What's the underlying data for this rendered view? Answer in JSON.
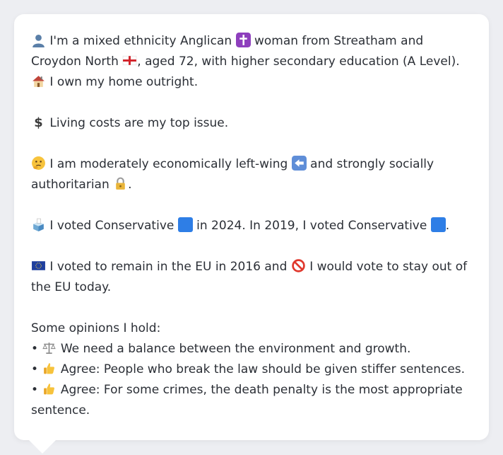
{
  "profile": {
    "intro_1": "I'm a mixed ethnicity Anglican",
    "intro_2": "woman from Streatham and Croydon North",
    "intro_3": ", aged 72, with higher secondary education (A Level).",
    "intro_4": "I own my home outright.",
    "issue": "Living costs are my top issue.",
    "politics_1": "I am moderately economically left-wing",
    "politics_2": "and strongly socially authoritarian",
    "politics_3": ".",
    "vote_1": "I voted Conservative",
    "vote_2": "in 2024. In 2019, I voted Conservative",
    "vote_3": ".",
    "eu_1": "I voted to remain in the EU in 2016 and",
    "eu_2": "I would vote to stay out of the EU today.",
    "opinions_heading": "Some opinions I hold:",
    "opinions": [
      {
        "bullet": "•",
        "text": "We need a balance between the environment and growth."
      },
      {
        "bullet": "•",
        "text": "Agree: People who break the law should be given stiffer sentences."
      },
      {
        "bullet": "•",
        "text": "Agree: For some crimes, the death penalty is the most appropriate sentence."
      }
    ]
  },
  "icons": {
    "person": "person-icon",
    "cross": "latin-cross-icon",
    "flag_england": "england-flag-icon",
    "house": "house-icon",
    "dollar": "dollar-icon",
    "thinking": "thinking-face-icon",
    "left_arrow": "left-arrow-icon",
    "lock": "lock-icon",
    "ballot": "ballot-box-icon",
    "blue_square": "blue-square-icon",
    "eu_flag": "eu-flag-icon",
    "prohibited": "prohibited-icon",
    "scales": "balance-scale-icon",
    "thumbs_up": "thumbs-up-icon"
  },
  "colors": {
    "conservative_blue": "#2e7ee6",
    "card_bg": "#ffffff",
    "page_bg": "#edeef2",
    "text": "#2b2f36"
  }
}
